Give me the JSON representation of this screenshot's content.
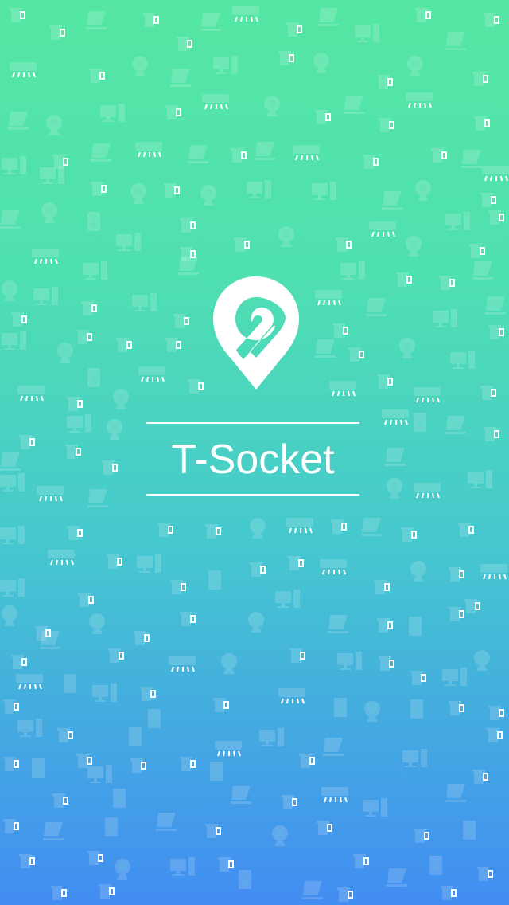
{
  "splash": {
    "app_name": "T-Socket",
    "logo_icon": "location-pin-logo-icon",
    "background_pattern_icons": [
      "kettle-icon",
      "laptop-icon",
      "air-conditioner-icon",
      "desktop-computer-icon",
      "speaker-icon",
      "fan-icon"
    ]
  },
  "colors": {
    "gradient_top": "#55e6a3",
    "gradient_bottom": "#428df2",
    "foreground": "#ffffff",
    "pattern": "#ffffff"
  }
}
